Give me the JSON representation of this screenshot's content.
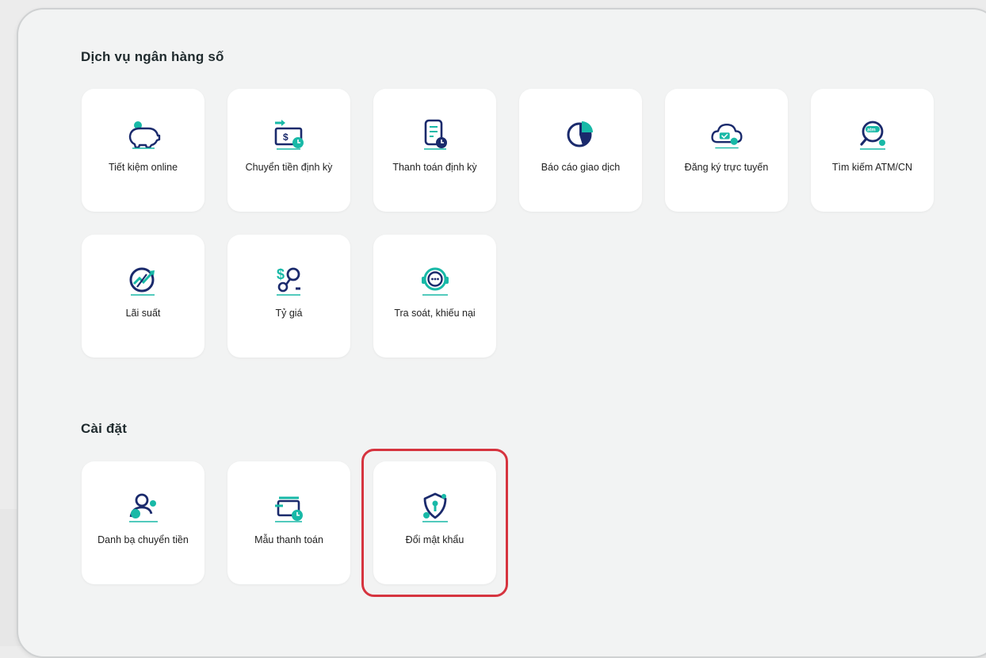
{
  "sections": [
    {
      "title": "Dịch vụ ngân hàng số",
      "items": [
        {
          "label": "Tiết kiệm online",
          "icon": "piggy-bank-icon"
        },
        {
          "label": "Chuyển tiền định kỳ",
          "icon": "money-transfer-icon"
        },
        {
          "label": "Thanh toán định kỳ",
          "icon": "recurring-bill-icon"
        },
        {
          "label": "Báo cáo giao dịch",
          "icon": "pie-chart-icon"
        },
        {
          "label": "Đăng ký trực tuyến",
          "icon": "cloud-register-icon"
        },
        {
          "label": "Tìm kiếm ATM/CN",
          "icon": "atm-search-icon"
        },
        {
          "label": "Lãi suất",
          "icon": "interest-rate-icon"
        },
        {
          "label": "Tỷ giá",
          "icon": "exchange-rate-icon"
        },
        {
          "label": "Tra soát, khiếu nại",
          "icon": "support-chat-icon"
        }
      ]
    },
    {
      "title": "Cài đặt",
      "items": [
        {
          "label": "Danh bạ chuyển tiền",
          "icon": "contacts-icon"
        },
        {
          "label": "Mẫu thanh toán",
          "icon": "payment-template-icon"
        },
        {
          "label": "Đổi mật khẩu",
          "icon": "shield-key-icon"
        }
      ]
    }
  ],
  "highlighted_item": "Đổi mật khẩu",
  "colors": {
    "accent_blue": "#1a2a6c",
    "accent_teal": "#18b9a7",
    "highlight_red": "#d6343f",
    "tile_bg": "#ffffff",
    "panel_bg": "#f2f3f3"
  }
}
